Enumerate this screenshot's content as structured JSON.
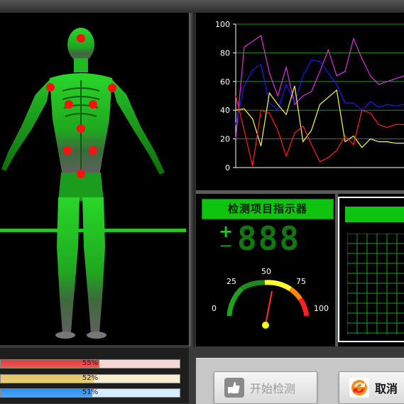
{
  "chart_data": {
    "type": "line",
    "y_ticks": [
      "100",
      "80",
      "60",
      "40",
      "20",
      "0"
    ],
    "ylim": [
      0,
      100
    ],
    "x": [
      0,
      1,
      2,
      3,
      4,
      5,
      6,
      7,
      8,
      9,
      10,
      11,
      12,
      13,
      14,
      15,
      16,
      17,
      18,
      19,
      20
    ],
    "series": [
      {
        "color": "#e030e0",
        "values": [
          20,
          84,
          88,
          92,
          66,
          50,
          70,
          44,
          50,
          53,
          67,
          82,
          64,
          67,
          90,
          76,
          64,
          58,
          60,
          62,
          64
        ]
      },
      {
        "color": "#1a1aff",
        "values": [
          30,
          57,
          68,
          72,
          45,
          40,
          58,
          45,
          64,
          75,
          74,
          66,
          58,
          45,
          45,
          40,
          46,
          42,
          44,
          43,
          44
        ]
      },
      {
        "color": "#ffff40",
        "values": [
          40,
          41,
          34,
          15,
          52,
          44,
          37,
          57,
          18,
          26,
          44,
          49,
          54,
          18,
          22,
          14,
          20,
          18,
          18,
          17,
          17
        ]
      },
      {
        "color": "#ff2020",
        "values": [
          50,
          26,
          1,
          40,
          38,
          26,
          8,
          24,
          29,
          16,
          4,
          7,
          12,
          22,
          16,
          40,
          38,
          30,
          28,
          30,
          30
        ]
      }
    ]
  },
  "indicator": {
    "title": "检测项目指示器",
    "plus": "+",
    "minus": "−",
    "digits": "888"
  },
  "gauge": {
    "labels": [
      "0",
      "25",
      "50",
      "75",
      "100"
    ],
    "value": 55
  },
  "progress_bars": [
    {
      "value": 55,
      "label": "55%",
      "color": "#e33b3b",
      "track": "#f7d6d6"
    },
    {
      "value": 52,
      "label": "52%",
      "color": "#e4c46a",
      "track": "#f7edcf"
    },
    {
      "value": 51,
      "label": "51%",
      "color": "#2c90f0",
      "track": "#d6ecff"
    }
  ],
  "buttons": {
    "start_label": "开始检测",
    "cancel_label": "取消"
  },
  "colors": {
    "body_green": "#20c020",
    "accent_green": "#0fc40f",
    "acupoint_red": "#ff1010"
  },
  "icons": {
    "start": "thumb-up-icon",
    "cancel": "cancel-arrows-icon"
  }
}
